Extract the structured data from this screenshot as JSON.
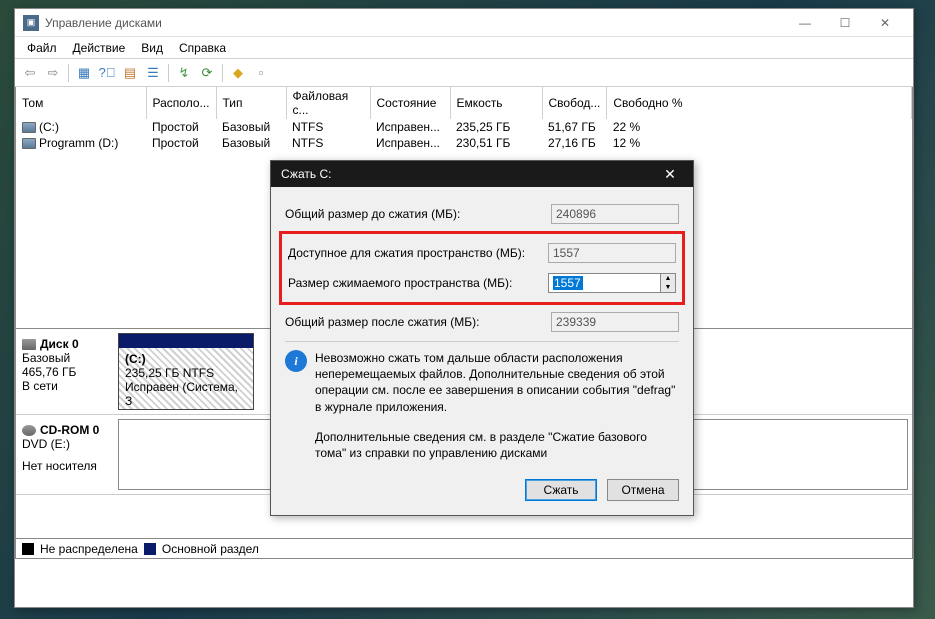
{
  "main": {
    "title": "Управление дисками",
    "menu": [
      "Файл",
      "Действие",
      "Вид",
      "Справка"
    ],
    "columns": [
      "Том",
      "Располо...",
      "Тип",
      "Файловая с...",
      "Состояние",
      "Емкость",
      "Свобод...",
      "Свободно %"
    ],
    "volumes": [
      {
        "name": "(C:)",
        "layout": "Простой",
        "type": "Базовый",
        "fs": "NTFS",
        "status": "Исправен...",
        "capacity": "235,25 ГБ",
        "free": "51,67 ГБ",
        "pct": "22 %"
      },
      {
        "name": "Programm (D:)",
        "layout": "Простой",
        "type": "Базовый",
        "fs": "NTFS",
        "status": "Исправен...",
        "capacity": "230,51 ГБ",
        "free": "27,16 ГБ",
        "pct": "12 %"
      }
    ],
    "disk0": {
      "title": "Диск 0",
      "type": "Базовый",
      "size": "465,76 ГБ",
      "status": "В сети",
      "part_name": "(C:)",
      "part_detail": "235,25 ГБ NTFS",
      "part_status": "Исправен (Система, З"
    },
    "cdrom": {
      "title": "CD-ROM 0",
      "detail": "DVD (E:)",
      "status": "Нет носителя"
    },
    "legend": {
      "unalloc": "Не распределена",
      "primary": "Основной раздел"
    }
  },
  "dialog": {
    "title": "Сжать C:",
    "rows": {
      "before_label": "Общий размер до сжатия (МБ):",
      "before_val": "240896",
      "avail_label": "Доступное для сжатия пространство (МБ):",
      "avail_val": "1557",
      "shrink_label": "Размер сжимаемого пространства (МБ):",
      "shrink_val": "1557",
      "after_label": "Общий размер после сжатия (МБ):",
      "after_val": "239339"
    },
    "info1": "Невозможно сжать том дальше области расположения неперемещаемых файлов. Дополнительные сведения об этой операции см. после ее завершения в описании события \"defrag\" в журнале приложения.",
    "info2": "Дополнительные сведения см. в разделе \"Сжатие базового тома\" из справки по управлению дисками",
    "btn_ok": "Сжать",
    "btn_cancel": "Отмена"
  }
}
